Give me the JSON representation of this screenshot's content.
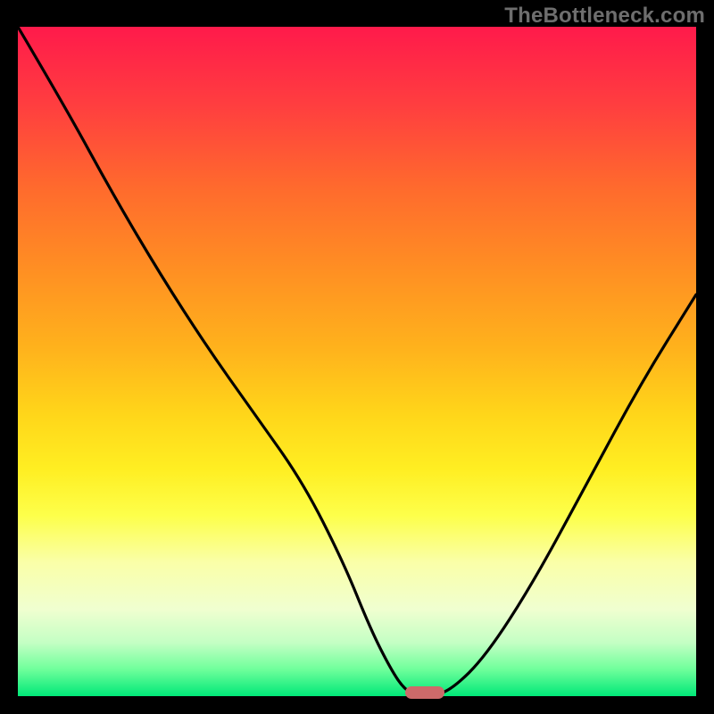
{
  "watermark": "TheBottleneck.com",
  "colors": {
    "frame": "#000000",
    "curve_stroke": "#000000",
    "marker_fill": "#cd6a6a"
  },
  "chart_data": {
    "type": "line",
    "title": "",
    "xlabel": "",
    "ylabel": "",
    "xlim": [
      0,
      100
    ],
    "ylim": [
      0,
      100
    ],
    "grid": false,
    "legend": false,
    "axes_visible": false,
    "series": [
      {
        "name": "bottleneck-curve",
        "x": [
          0,
          7,
          14,
          21,
          28,
          35,
          42,
          48,
          52,
          55,
          57,
          59,
          61,
          64,
          69,
          76,
          84,
          92,
          100
        ],
        "y": [
          100,
          88,
          75,
          63,
          52,
          42,
          32,
          20,
          10,
          4,
          1,
          0,
          0,
          1,
          6,
          17,
          32,
          47,
          60
        ]
      }
    ],
    "marker": {
      "x": 60,
      "y": 0,
      "shape": "rounded-bar"
    },
    "background_gradient": [
      {
        "stop": 0,
        "color": "#ff1a4b"
      },
      {
        "stop": 50,
        "color": "#ffd61a"
      },
      {
        "stop": 80,
        "color": "#faffa8"
      },
      {
        "stop": 100,
        "color": "#00e878"
      }
    ]
  }
}
